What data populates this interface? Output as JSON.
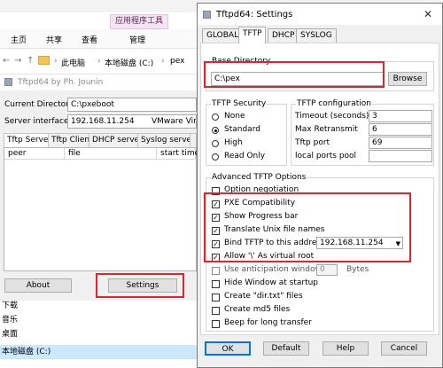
{
  "explorer": {
    "ribbon_group": "应用程序工具",
    "tabs": [
      "主页",
      "共享",
      "查看",
      "管理"
    ],
    "breadcrumb": [
      "此电脑",
      "本地磁盘 (C:)",
      "pex"
    ],
    "sidebar_items": [
      "下载",
      "音乐",
      "桌面",
      "本地磁盘 (C:)"
    ],
    "sidebar_selected": "本地磁盘 (C:)"
  },
  "main": {
    "title": "Tftpd64 by Ph. Jounin",
    "current_directory_label": "Current Directory",
    "current_directory": "C:\\pxeboot",
    "server_interfaces_label": "Server interfaces",
    "server_interface_ip": "192.168.11.254",
    "server_interface_adapter": "VMware Virtu",
    "tabs": [
      "Tftp Server",
      "Tftp Client",
      "DHCP server",
      "Syslog server"
    ],
    "active_tab": "Tftp Server",
    "columns": [
      "peer",
      "file",
      "start time"
    ],
    "about_button": "About",
    "settings_button": "Settings"
  },
  "dialog": {
    "title": "Tftpd64: Settings",
    "close_symbol": "✕",
    "tabs": [
      "GLOBAL",
      "TFTP",
      "DHCP",
      "SYSLOG"
    ],
    "active_tab": "TFTP",
    "base_directory_label": "Base Directory",
    "base_directory": "C:\\pex",
    "browse_button": "Browse",
    "security": {
      "label": "TFTP Security",
      "options": [
        "None",
        "Standard",
        "High",
        "Read Only"
      ],
      "selected": "Standard"
    },
    "configuration": {
      "label": "TFTP configuration",
      "fields": [
        {
          "label": "Timeout (seconds)",
          "value": "3"
        },
        {
          "label": "Max Retransmit",
          "value": "6"
        },
        {
          "label": "Tftp port",
          "value": "69"
        },
        {
          "label": "local ports pool",
          "value": ""
        }
      ]
    },
    "advanced": {
      "label": "Advanced TFTP Options",
      "options": [
        {
          "label": "Option negotiation",
          "checked": false
        },
        {
          "label": "PXE Compatibility",
          "checked": true
        },
        {
          "label": "Show Progress bar",
          "checked": true
        },
        {
          "label": "Translate Unix file names",
          "checked": true
        },
        {
          "label": "Bind TFTP to this address",
          "checked": true
        },
        {
          "label": "Allow '\\' As virtual root",
          "checked": true
        },
        {
          "label": "Use anticipation window of",
          "checked": false
        },
        {
          "label": "Hide Window at startup",
          "checked": false
        },
        {
          "label": "Create \"dir.txt\" files",
          "checked": false
        },
        {
          "label": "Create md5 files",
          "checked": false
        },
        {
          "label": "Beep for long transfer",
          "checked": false
        }
      ],
      "bind_address": "192.168.11.254",
      "anticipation_value": "0",
      "anticipation_unit": "Bytes"
    },
    "buttons": {
      "ok": "OK",
      "default": "Default",
      "help": "Help",
      "cancel": "Cancel"
    }
  },
  "colors": {
    "highlight": "#e0252e",
    "selection": "#cce8ff",
    "ribbon_group_bg": "#f5e4f3"
  }
}
